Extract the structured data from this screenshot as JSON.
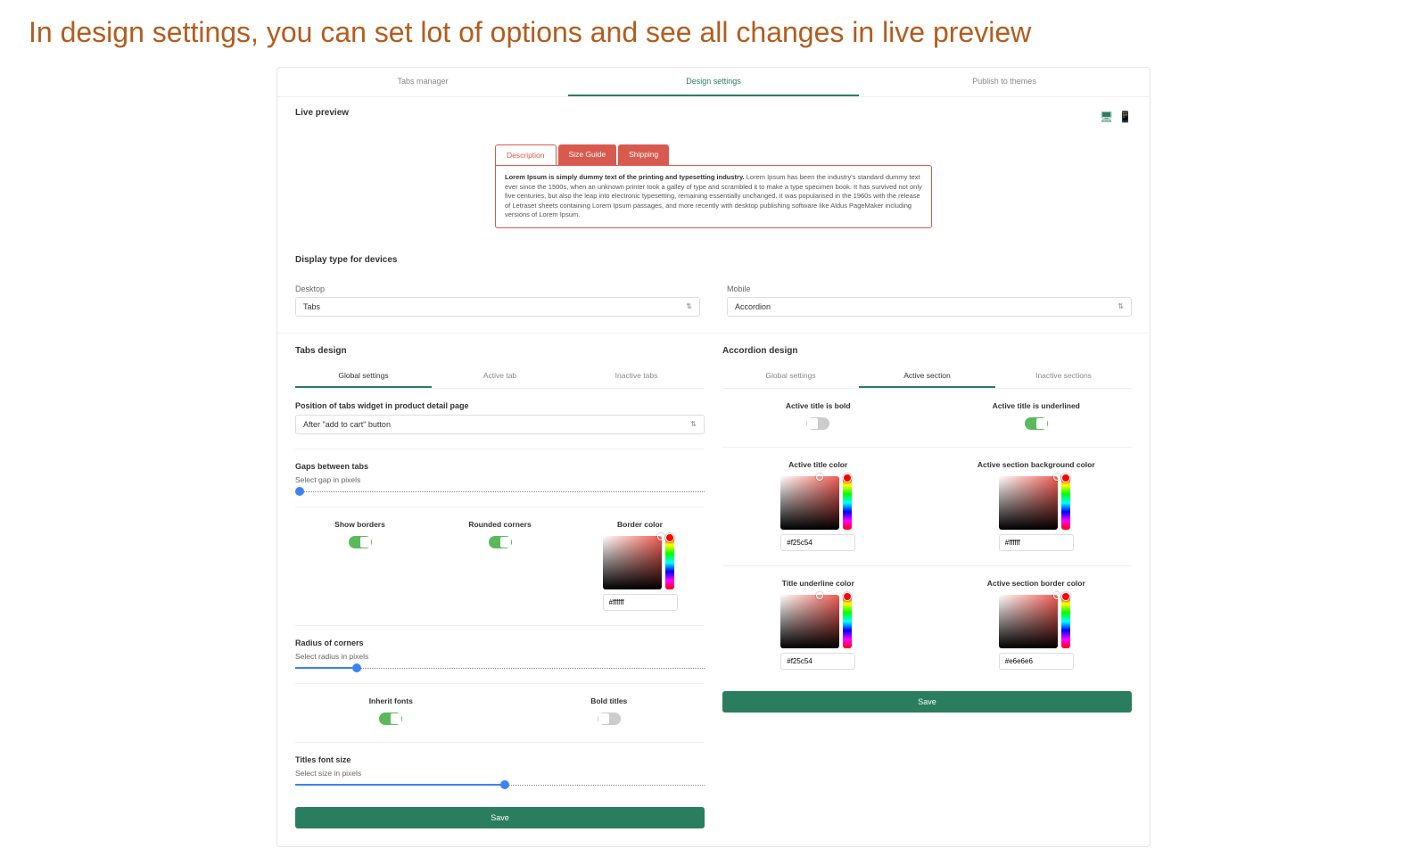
{
  "page_heading": "In design settings, you can set lot of options and see all changes in live preview",
  "main_tabs": {
    "tabs_manager": "Tabs manager",
    "design_settings": "Design settings",
    "publish": "Publish to themes"
  },
  "live_preview": {
    "title": "Live preview",
    "tabs": {
      "desc": "Description",
      "size": "Size Guide",
      "ship": "Shipping"
    },
    "content_bold": "Lorem Ipsum is simply dummy text of the printing and typesetting industry.",
    "content_rest": " Lorem Ipsum has been the industry's standard dummy text ever since the 1500s, when an unknown printer took a galley of type and scrambled it to make a type specimen book. It has survived not only five centuries, but also the leap into electronic typesetting, remaining essentially unchanged. It was popularised in the 1960s with the release of Letraset sheets containing Lorem Ipsum passages, and more recently with desktop publishing software like Aldus PageMaker including versions of Lorem Ipsum."
  },
  "display_type": {
    "title": "Display type for devices",
    "desktop_label": "Desktop",
    "desktop_value": "Tabs",
    "mobile_label": "Mobile",
    "mobile_value": "Accordion"
  },
  "tabs_design": {
    "title": "Tabs design",
    "subtabs": {
      "global": "Global settings",
      "active": "Active tab",
      "inactive": "Inactive tabs"
    },
    "position_label": "Position of tabs widget in product detail page",
    "position_value": "After \"add to cart\" button",
    "gaps_title": "Gaps between tabs",
    "gaps_label": "Select gap in pixels",
    "borders": "Show borders",
    "rounded": "Rounded corners",
    "border_color": "Border color",
    "border_color_value": "#ffffff",
    "radius_title": "Radius of corners",
    "radius_label": "Select radius in pixels",
    "inherit": "Inherit fonts",
    "bold_titles": "Bold titles",
    "font_size_title": "Titles font size",
    "font_size_label": "Select size in pixels",
    "save": "Save"
  },
  "accordion_design": {
    "title": "Accordion design",
    "subtabs": {
      "global": "Global settings",
      "active": "Active section",
      "inactive": "Inactive sections"
    },
    "bold": "Active title is bold",
    "underlined": "Active title is underlined",
    "title_color": "Active title color",
    "title_color_value": "#f25c54",
    "bg_color": "Active section background color",
    "bg_color_value": "#ffffff",
    "underline_color": "Title underline color",
    "underline_color_value": "#f25c54",
    "border_color": "Active section border color",
    "border_color_value": "#e6e6e6",
    "save": "Save"
  }
}
